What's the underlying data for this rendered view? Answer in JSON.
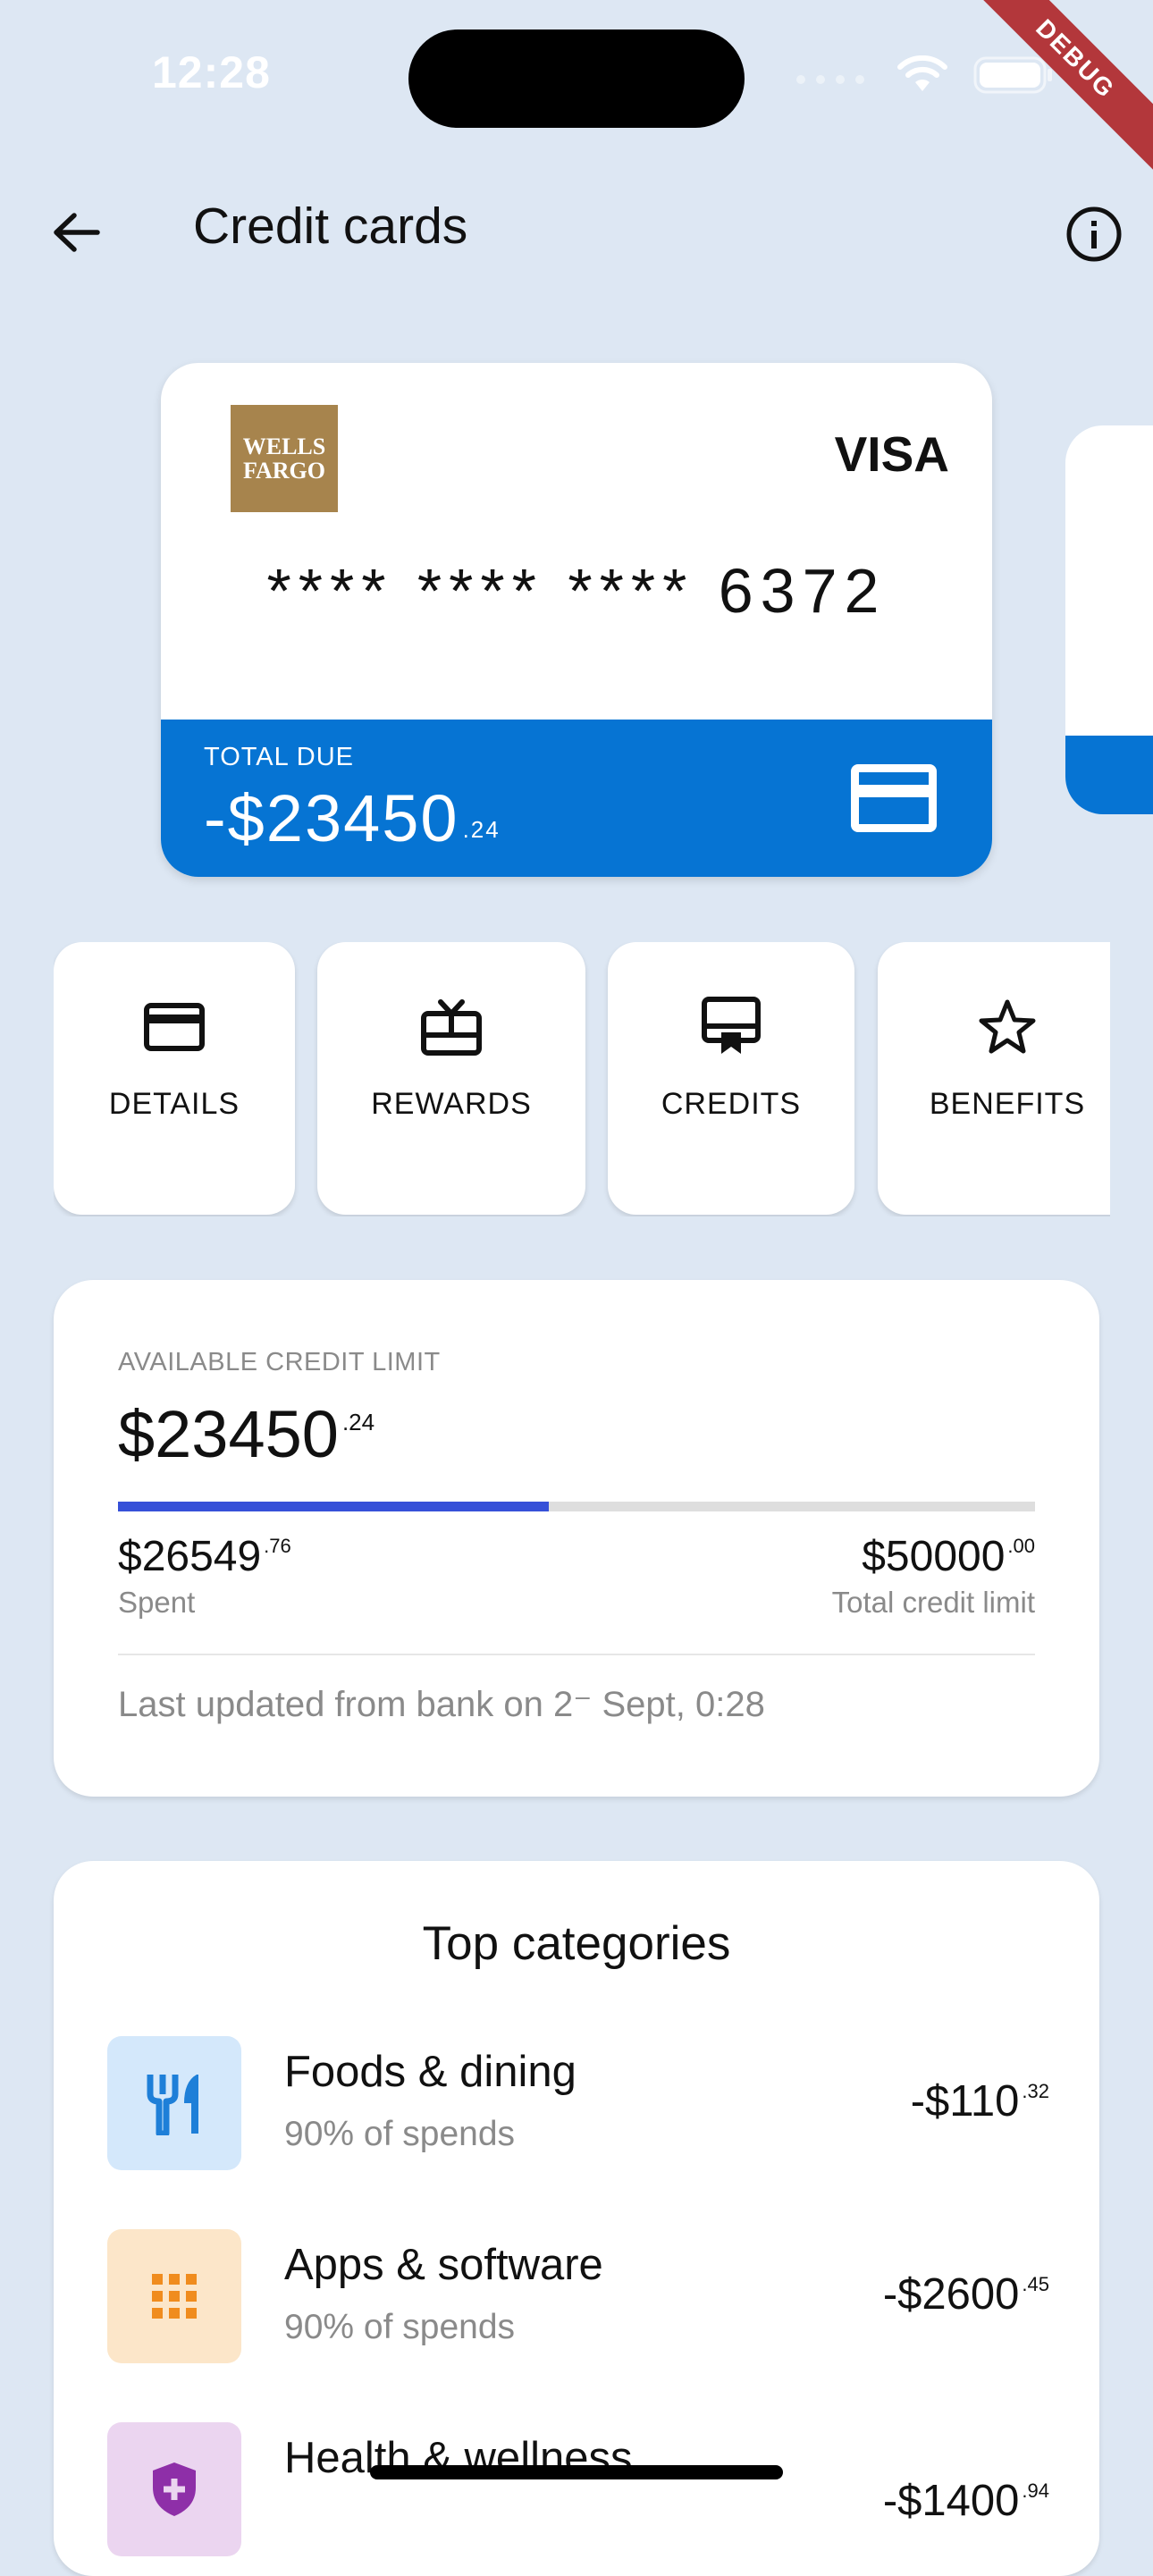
{
  "status_bar": {
    "time": "12:28",
    "debug_label": "DEBUG"
  },
  "app_bar": {
    "title": "Credit cards",
    "back_icon": "arrow-left-icon",
    "info_icon": "info-circle-icon"
  },
  "card": {
    "bank": {
      "line1": "WELLS",
      "line2": "FARGO"
    },
    "network": "VISA",
    "number": "**** **** **** 6372",
    "total_due_label": "TOTAL DUE",
    "total_due": "-$23450",
    "total_due_cents": ".24",
    "accent_color": "#0674D3"
  },
  "actions": [
    {
      "label": "DETAILS",
      "icon": "credit-card-icon"
    },
    {
      "label": "REWARDS",
      "icon": "gift-card-icon"
    },
    {
      "label": "CREDITS",
      "icon": "card-membership-icon"
    },
    {
      "label": "BENEFITS",
      "icon": "star-outline-icon"
    }
  ],
  "credit_limit": {
    "label": "AVAILABLE CREDIT LIMIT",
    "available": "$23450",
    "available_cents": ".24",
    "spent": "$26549",
    "spent_cents": ".76",
    "spent_label": "Spent",
    "total": "$50000",
    "total_cents": ".00",
    "total_label": "Total credit limit",
    "progress_fraction": 0.47,
    "progress_color": "#3650D8",
    "updated_text": "Last updated from bank on 2⁻ Sept, 0:28"
  },
  "categories": {
    "title": "Top categories",
    "items": [
      {
        "name": "Foods & dining",
        "sub": "90% of spends",
        "amount": "-$110",
        "cents": ".32",
        "icon": "restaurant-icon",
        "bg": "#D4E8FB",
        "fg": "#1E7FD8"
      },
      {
        "name": "Apps & software",
        "sub": "90% of spends",
        "amount": "-$2600",
        "cents": ".45",
        "icon": "apps-grid-icon",
        "bg": "#FCE6C9",
        "fg": "#F08C1E"
      },
      {
        "name": "Health & wellness",
        "sub": "",
        "amount": "-$1400",
        "cents": ".94",
        "icon": "health-shield-icon",
        "bg": "#EBD5F0",
        "fg": "#8E2FA8"
      }
    ]
  }
}
